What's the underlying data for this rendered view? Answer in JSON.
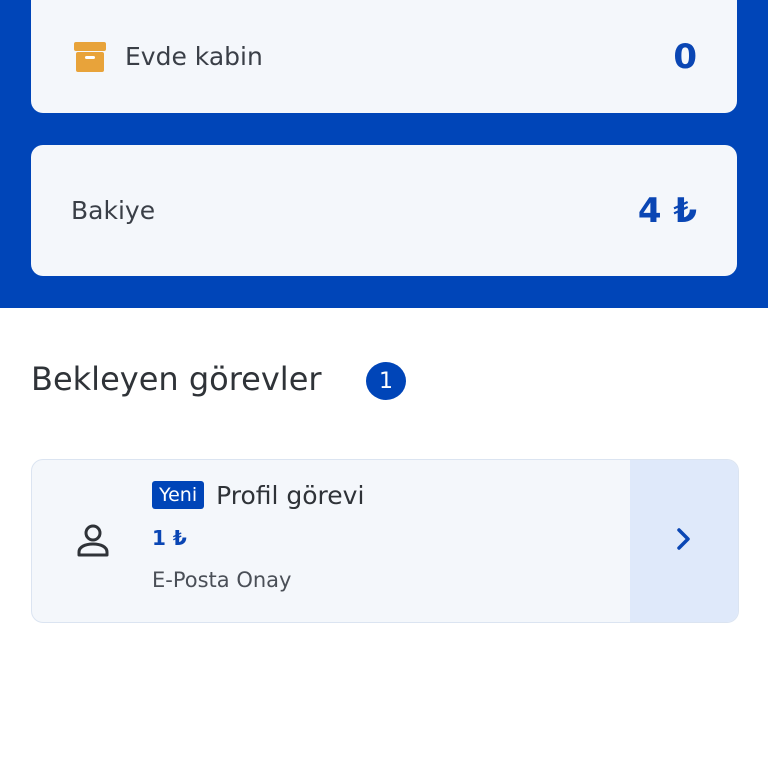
{
  "home_cabin": {
    "label": "Evde kabin",
    "value": "0",
    "icon": "archive-box-icon",
    "icon_color": "#e8a33a"
  },
  "balance": {
    "label": "Bakiye",
    "value": "4 ₺"
  },
  "pending_tasks": {
    "title": "Bekleyen görevler",
    "count": "1",
    "items": [
      {
        "tag": "Yeni",
        "title": "Profil görevi",
        "reward": "1 ₺",
        "description": "E-Posta Onay",
        "icon": "user-icon"
      }
    ]
  },
  "colors": {
    "brand_blue": "#0045b8",
    "card_bg": "#f4f7fb",
    "arrow_bg": "#dfe9fa"
  }
}
